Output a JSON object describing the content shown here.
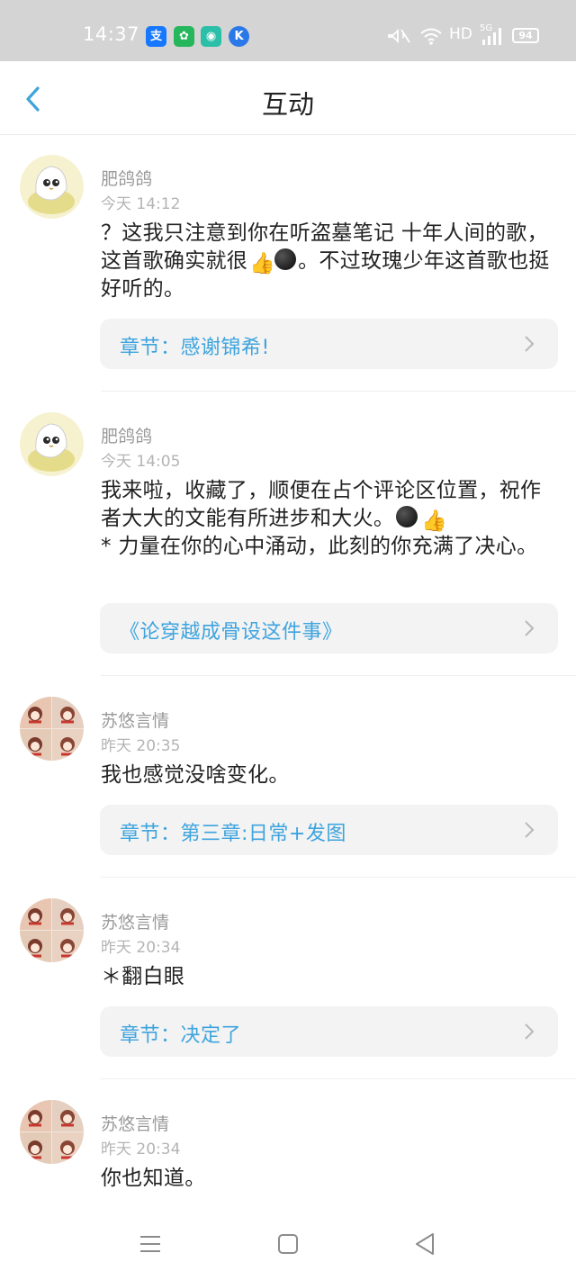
{
  "status_bar": {
    "time": "14:37",
    "app_icons": [
      {
        "name": "alipay-icon",
        "glyph": "支",
        "color": "#1677ff"
      },
      {
        "name": "green-app-icon",
        "glyph": "✿",
        "color": "#26b65c"
      },
      {
        "name": "chat-app-icon",
        "glyph": "◉",
        "color": "#2cbfa8"
      },
      {
        "name": "k-app-icon",
        "glyph": "K",
        "color": "#2b79e8"
      }
    ],
    "network": "HD",
    "signal": "5G",
    "battery": "94"
  },
  "header": {
    "title": "互动",
    "accent": "#3ea4de"
  },
  "comments": [
    {
      "user": "肥鸽鸽",
      "time": "今天 14:12",
      "text_parts": [
        "？这我只注意到你在听盗墓笔记 十年人间的歌，这首歌确实就很",
        "。不过玫瑰少年这首歌也挺好听的。"
      ],
      "emoji": [
        "thumbs-up",
        "dark-face"
      ],
      "link": "章节：感谢锦希!"
    },
    {
      "user": "肥鸽鸽",
      "time": "今天 14:05",
      "text_parts": [
        "我来啦，收藏了，顺便在占个评论区位置，祝作者大大的文能有所进步和大火。",
        "* 力量在你的心中涌动，此刻的你充满了决心。"
      ],
      "emoji": [
        "dark-face",
        "thumbs-up"
      ],
      "link": "《论穿越成骨设这件事》"
    },
    {
      "user": "苏悠言情",
      "time": "昨天 20:35",
      "text": "我也感觉没啥变化。",
      "link": "章节：第三章:日常+发图"
    },
    {
      "user": "苏悠言情",
      "time": "昨天 20:34",
      "text": "＊翻白眼",
      "link": "章节：决定了"
    },
    {
      "user": "苏悠言情",
      "time": "昨天 20:34",
      "text": "你也知道。",
      "link": ""
    }
  ]
}
